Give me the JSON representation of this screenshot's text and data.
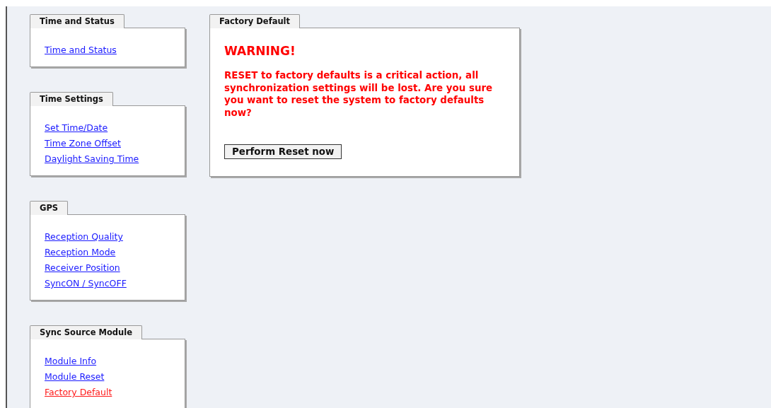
{
  "sidebar": {
    "groups": [
      {
        "title": "Time and Status",
        "items": [
          {
            "label": "Time and Status",
            "selected": false
          }
        ]
      },
      {
        "title": "Time Settings",
        "items": [
          {
            "label": "Set Time/Date",
            "selected": false
          },
          {
            "label": "Time Zone Offset",
            "selected": false
          },
          {
            "label": "Daylight Saving Time",
            "selected": false
          }
        ]
      },
      {
        "title": "GPS",
        "items": [
          {
            "label": "Reception Quality",
            "selected": false
          },
          {
            "label": "Reception Mode",
            "selected": false
          },
          {
            "label": "Receiver Position",
            "selected": false
          },
          {
            "label": "SyncON / SyncOFF",
            "selected": false
          }
        ]
      },
      {
        "title": "Sync Source Module",
        "items": [
          {
            "label": "Module Info",
            "selected": false
          },
          {
            "label": "Module Reset",
            "selected": false
          },
          {
            "label": "Factory Default",
            "selected": true
          }
        ]
      }
    ]
  },
  "panel": {
    "title": "Factory Default",
    "heading": "WARNING!",
    "message": "RESET to factory defaults is a critical action, all synchronization settings will be lost. Are you sure you want to reset the system to factory defaults now?",
    "button": "Perform Reset now"
  }
}
